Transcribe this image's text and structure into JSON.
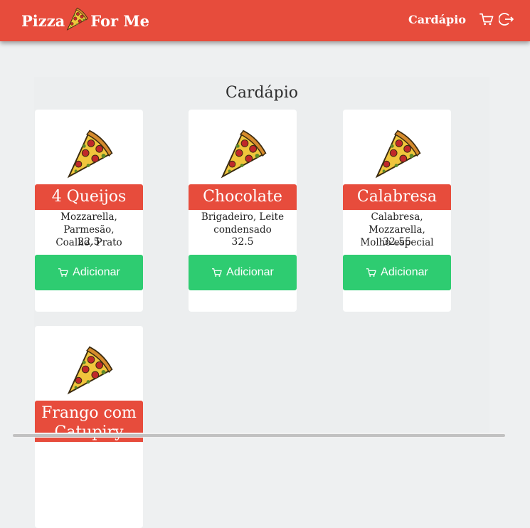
{
  "navbar": {
    "brand_left": "Pizza",
    "brand_right": "For Me",
    "brand_icon": "pizza-slice-icon",
    "menu_link": "Cardápio",
    "cart_icon": "cart-icon",
    "logout_icon": "logout-icon",
    "background_color": "#e74c3c"
  },
  "menu": {
    "title": "Cardápio",
    "add_label": "Adicionar",
    "add_button_color": "#2ecc71",
    "items": [
      {
        "name": "4 Queijos",
        "desc_line1": "Mozzarella, Parmesão,",
        "desc_line2": "Coalho, Prato",
        "price": "22.5"
      },
      {
        "name": "Chocolate",
        "desc_line1": "Brigadeiro, Leite",
        "desc_line2": "condensado",
        "price": "32.5"
      },
      {
        "name": "Calabresa",
        "desc_line1": "Calabresa, Mozzarella,",
        "desc_line2": "Molho especial",
        "price": "32.55"
      },
      {
        "name": "Frango com Catupiry",
        "desc_line1": "",
        "desc_line2": "",
        "price": ""
      }
    ]
  }
}
